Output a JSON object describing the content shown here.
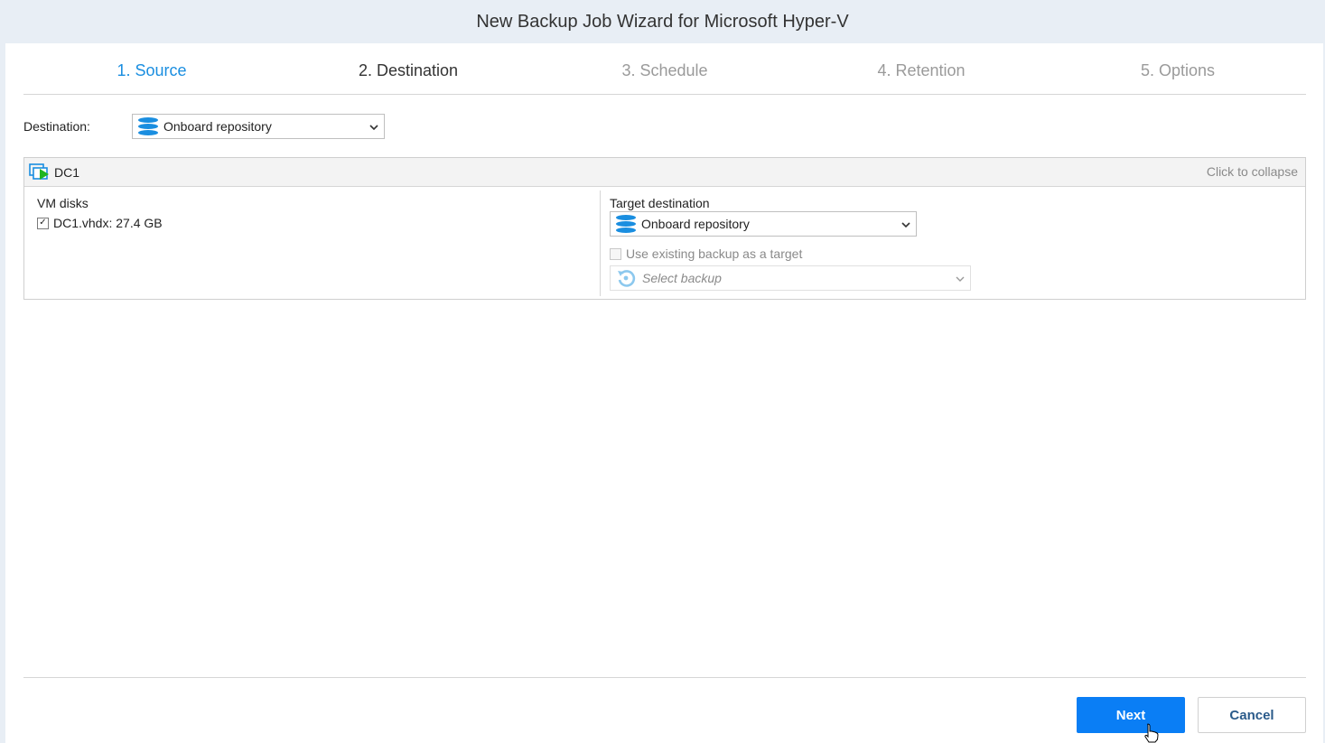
{
  "window": {
    "title": "New Backup Job Wizard for Microsoft Hyper-V"
  },
  "steps": [
    {
      "label": "1. Source",
      "state": "completed"
    },
    {
      "label": "2. Destination",
      "state": "current"
    },
    {
      "label": "3. Schedule",
      "state": "pending"
    },
    {
      "label": "4. Retention",
      "state": "pending"
    },
    {
      "label": "5. Options",
      "state": "pending"
    }
  ],
  "destination": {
    "label": "Destination:",
    "value": "Onboard repository"
  },
  "vm": {
    "name": "DC1",
    "collapse_label": "Click to collapse",
    "disks_label": "VM disks",
    "disks": [
      {
        "label": "DC1.vhdx: 27.4 GB",
        "checked": true
      }
    ],
    "target_label": "Target destination",
    "target_value": "Onboard repository",
    "use_existing_label": "Use existing backup as a target",
    "use_existing_checked": false,
    "select_backup_placeholder": "Select backup"
  },
  "buttons": {
    "next": "Next",
    "cancel": "Cancel"
  },
  "colors": {
    "accent": "#1a8ee0",
    "primary_button": "#0a7ef5",
    "titlebar": "#e8eef5"
  },
  "icons": [
    "database-icon",
    "vm-icon",
    "chevron-down-icon",
    "backup-restore-icon",
    "hand-cursor-icon"
  ]
}
